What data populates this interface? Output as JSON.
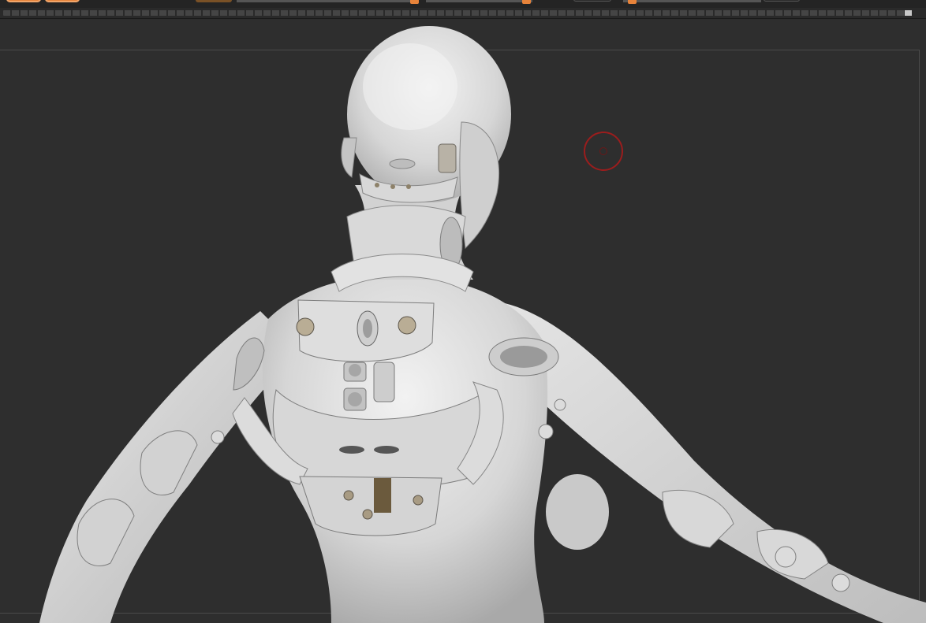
{
  "toolbar": {
    "buttons": [
      {
        "name": "tool-button-1",
        "color": "#e7833a"
      },
      {
        "name": "tool-button-2",
        "color": "#e7833a"
      }
    ],
    "active_button_color": "#7a5126",
    "sliders": [
      {
        "name": "slider-1",
        "accent": "#e7833a"
      },
      {
        "name": "slider-2",
        "accent": "#e7833a"
      },
      {
        "name": "slider-3",
        "accent": "#e7833a"
      }
    ]
  },
  "viewport": {
    "background": "#2e2e2e",
    "model_color": "#dcdcdc",
    "subject": "sculpted-figure-back-view",
    "brush_cursor_color": "#9b1d1d"
  }
}
